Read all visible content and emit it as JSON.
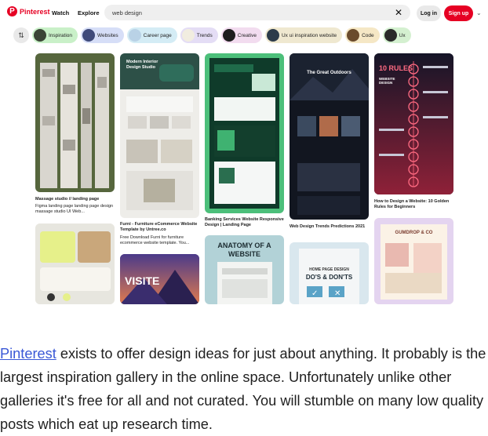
{
  "header": {
    "logo_text": "Pinterest",
    "nav": [
      "Watch",
      "Explore"
    ],
    "search_value": "web design",
    "login_label": "Log in",
    "signup_label": "Sign up"
  },
  "chips": [
    {
      "label": "Inspiration",
      "color": "#c9f0c8"
    },
    {
      "label": "Websites",
      "color": "#d6def7"
    },
    {
      "label": "Career page",
      "color": "#d4ecf5"
    },
    {
      "label": "Trends",
      "color": "#e4ddf5"
    },
    {
      "label": "Creative",
      "color": "#f2dcef"
    },
    {
      "label": "Ux ui inspiration website",
      "color": "#efe8d0"
    },
    {
      "label": "Code",
      "color": "#f5e7c5"
    },
    {
      "label": "Ux",
      "color": "#d4f0d0"
    }
  ],
  "pins": {
    "p1_caption": "Massage studio // landing page",
    "p1_desc": "Figma landing page landing page design massage studio UI Web...",
    "p2_title": "Modern Interior Design Studio",
    "p2_caption": "Furni - Furniture eCommerce Website Template by Untree.co",
    "p2_desc": "Free Download Furni for furniture ecommerce website template. You...",
    "p3_caption": "Banking Services Website Responsive Design | Landing Page",
    "p3b_text": "ANATOMY OF A WEBSITE",
    "p4_title": "The Great Outdoors",
    "p4_caption": "Web Design Trends Predictions 2021",
    "p4b_text1": "HOME PAGE DESIGN",
    "p4b_text2": "DO'S & DON'TS",
    "p5_title": "10 RULES",
    "p5_sub": "WEBSITE DESIGN",
    "p5_caption": "How to Design a Website: 10 Golden Rules for Beginners",
    "p5b_brand": "GUMDROP & CO",
    "p2b_text": "VISITE"
  },
  "article": {
    "link_text": "Pinterest",
    "body": " exists to offer design ideas for just about anything. It probably is the largest inspiration gallery in the online space. Unfortunately unlike other galleries it's free for all and not curated. You will stumble on many low quality posts which eat up research time."
  }
}
